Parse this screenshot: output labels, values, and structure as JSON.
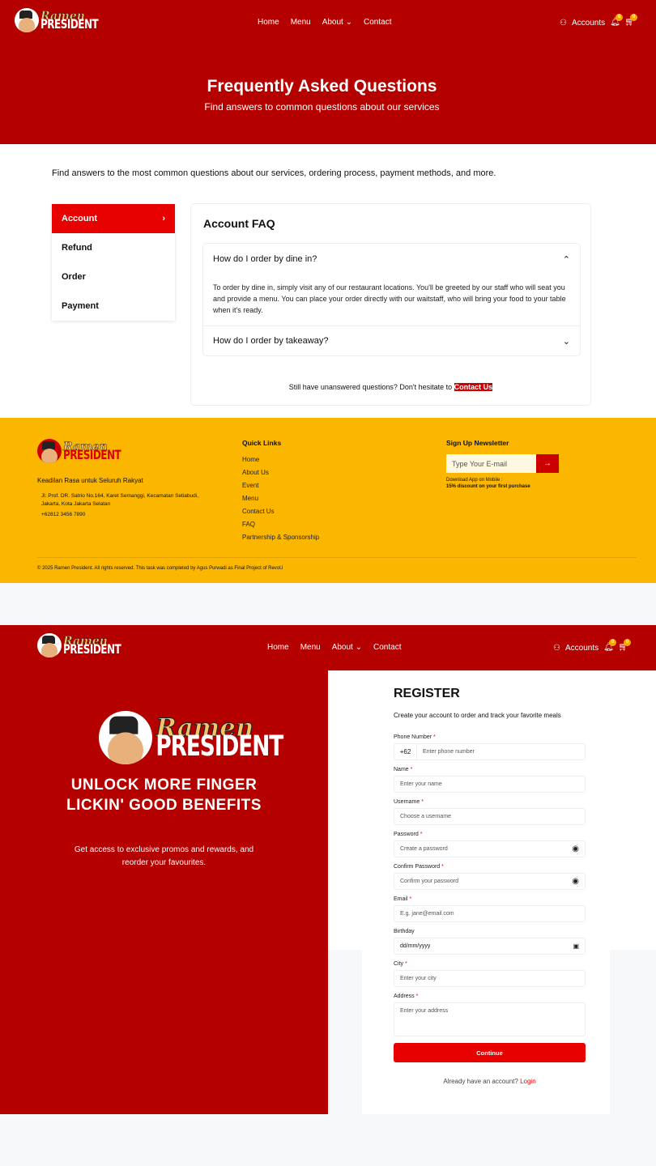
{
  "brand": {
    "line1": "Ramen",
    "line2": "PRESIDENT"
  },
  "nav": {
    "items": [
      "Home",
      "Menu",
      "About",
      "Contact"
    ],
    "accounts": "Accounts",
    "notif_count": "0",
    "cart_count": "0"
  },
  "hero": {
    "title": "Frequently Asked Questions",
    "subtitle": "Find answers to common questions about our services"
  },
  "intro": "Find answers to the most common questions about our services, ordering process, payment methods, and more.",
  "faq": {
    "categories": [
      "Account",
      "Refund",
      "Order",
      "Payment"
    ],
    "active": "Account",
    "heading": "Account FAQ",
    "items": [
      {
        "q": "How do I order by dine in?",
        "a": "To order by dine in, simply visit any of our restaurant locations. You'll be greeted by our staff who will seat you and provide a menu. You can place your order directly with our waitstaff, who will bring your food to your table when it's ready.",
        "open": true
      },
      {
        "q": "How do I order by takeaway?",
        "open": false
      }
    ],
    "still": "Still have unanswered questions? Don't hesitate to",
    "contact": "Contact Us"
  },
  "footer": {
    "tagline": "Keadilan Rasa untuk Seluruh Rakyat",
    "address": "Jl. Prof. DR. Satrio No.164, Karet Semanggi, Kecamatan Setiabudi, Jakarta, Kota Jakarta Selatan",
    "phone": "+62812 3456 7890",
    "quick_title": "Quick Links",
    "links": [
      "Home",
      "About Us",
      "Event",
      "Menu",
      "Contact Us",
      "FAQ",
      "Partnership & Sponsorship"
    ],
    "news_title": "Sign Up Newsletter",
    "email_placeholder": "Type Your E-mail",
    "download": "Download App on Mobile :",
    "discount": "15% discount on your first purchase",
    "copyright": "© 2025 Ramen President. All rights reserved. This task was completed by Agus Purwadi as Final Project of RevoU"
  },
  "promo": {
    "title": "UNLOCK MORE FINGER LICKIN' GOOD BENEFITS",
    "text": "Get access to exclusive promos and rewards, and reorder your favourites."
  },
  "register": {
    "title": "REGISTER",
    "subtitle": "Create your account to order and track your favorite meals",
    "prefix": "+62",
    "fields": [
      {
        "label": "Phone Number",
        "ph": "Enter phone number"
      },
      {
        "label": "Name",
        "ph": "Enter your name"
      },
      {
        "label": "Username",
        "ph": "Choose a username"
      },
      {
        "label": "Password",
        "ph": "Create a password"
      },
      {
        "label": "Confirm Password",
        "ph": "Confirm your password"
      },
      {
        "label": "Email",
        "ph": "E.g. jane@email.com"
      },
      {
        "label": "Birthday",
        "ph": "dd/mm/yyyy"
      },
      {
        "label": "City",
        "ph": "Enter your city"
      },
      {
        "label": "Address",
        "ph": "Enter your address"
      }
    ],
    "required": "*",
    "continue": "Continue",
    "have_account": "Already have an account?",
    "login": "Login"
  },
  "colors": {
    "red": "#b50000",
    "accent": "#e60000",
    "yellow": "#fbb600"
  }
}
